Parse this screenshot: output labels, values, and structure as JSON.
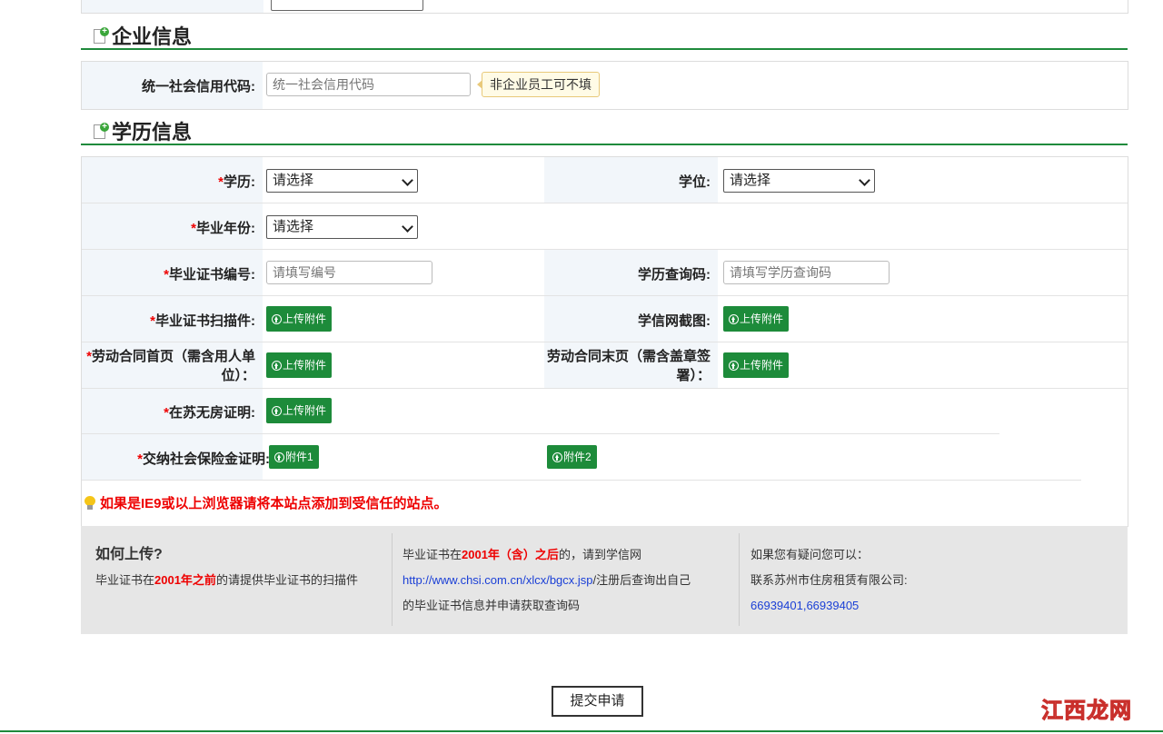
{
  "sections": {
    "company_title": "企业信息",
    "education_title": "学历信息"
  },
  "company": {
    "credit_code_label": "统一社会信用代码:",
    "credit_code_placeholder": "统一社会信用代码",
    "credit_code_tip": "非企业员工可不填"
  },
  "education": {
    "degree_label": "学历:",
    "degree_value": "请选择",
    "academic_degree_label": "学位:",
    "academic_degree_value": "请选择",
    "grad_year_label": "毕业年份:",
    "grad_year_value": "请选择",
    "cert_no_label": "毕业证书编号:",
    "cert_no_placeholder": "请填写编号",
    "query_code_label": "学历查询码:",
    "query_code_placeholder": "请填写学历查询码",
    "cert_scan_label": "毕业证书扫描件:",
    "chsi_screenshot_label": "学信网截图:",
    "contract_first_label_1": "劳动合同首页（需含用人单",
    "contract_first_label_2": "位）：",
    "contract_last_label_1": "劳动合同末页（需含盖章签",
    "contract_last_label_2": "署）：",
    "no_house_label": "在苏无房证明:",
    "social_security_label": "交纳社会保险金证明:",
    "upload_label": "上传附件",
    "attach1_label": "附件1",
    "attach2_label": "附件2",
    "required_mark": "*"
  },
  "notice": "如果是IE9或以上浏览器请将本站点添加到受信任的站点。",
  "help": {
    "title": "如何上传?",
    "col1_pre": "毕业证书在",
    "col1_red": "2001年之前",
    "col1_post": "的请提供毕业证书的扫描件",
    "col2_line1_pre": "毕业证书在",
    "col2_line1_red": "2001年（含）之后",
    "col2_line1_post": "的，请到学信网",
    "col2_link": "http://www.chsi.com.cn/xlcx/bgcx.jsp",
    "col2_line2_post": "/注册后查询出自己",
    "col2_line3": "的毕业证书信息并申请获取查询码",
    "col3_line1": "如果您有疑问您可以：",
    "col3_line2": "联系苏州市住房租赁有限公司:",
    "col3_phone": "66939401,66939405"
  },
  "submit_label": "提交申请",
  "watermark": "江西龙网",
  "colors": {
    "green": "#1d8b3a",
    "required_red": "#e00000",
    "link_blue": "#1a3fd6"
  },
  "icons": [
    "add-document-icon",
    "upload-arrow-icon",
    "lightbulb-icon"
  ]
}
